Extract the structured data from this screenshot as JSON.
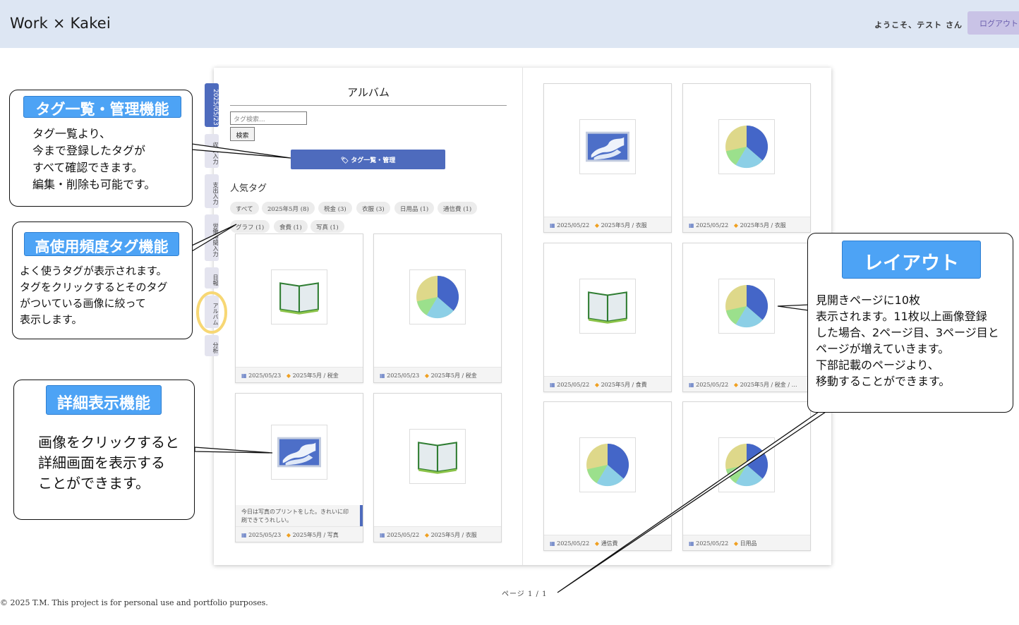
{
  "header": {
    "app_title": "Work × Kakei",
    "welcome": "ようこそ、テスト さん",
    "logout": "ログアウト"
  },
  "side_tabs": [
    {
      "label": "2025/05/23"
    },
    {
      "label": "収入入力"
    },
    {
      "label": "支出入力"
    },
    {
      "label": "労働時間入力"
    },
    {
      "label": "日報"
    },
    {
      "label": "アルバム"
    },
    {
      "label": "分析"
    }
  ],
  "album": {
    "title": "アルバム",
    "search_placeholder": "タグ検索...",
    "search_button": "検索",
    "tag_manage_button": "🏷 タグ一覧・管理",
    "popular_heading": "人気タグ",
    "tags": [
      "すべて",
      "2025年5月 (8)",
      "税金 (3)",
      "衣服 (3)",
      "日用品 (1)",
      "通信費 (1)",
      "グラフ (1)",
      "食費 (1)",
      "写真 (1)"
    ]
  },
  "cards": [
    {
      "icon": "book-icon",
      "date": "2025/05/23",
      "tag": "2025年5月 / 税金"
    },
    {
      "icon": "pie-chart-icon",
      "date": "2025/05/23",
      "tag": "2025年5月 / 税金"
    },
    {
      "icon": "photo-icon",
      "date": "2025/05/23",
      "tag": "2025年5月 / 写真",
      "note": "今日は写真のプリントをした。きれいに印刷できてうれしい。"
    },
    {
      "icon": "book-icon",
      "date": "2025/05/22",
      "tag": "2025年5月 / 衣服"
    },
    {
      "icon": "photo-icon",
      "date": "2025/05/22",
      "tag": "2025年5月 / 衣服"
    },
    {
      "icon": "pie-chart-icon",
      "date": "2025/05/22",
      "tag": "2025年5月 / 衣服"
    },
    {
      "icon": "book-icon",
      "date": "2025/05/22",
      "tag": "2025年5月 / 食費"
    },
    {
      "icon": "pie-chart-icon",
      "date": "2025/05/22",
      "tag": "2025年5月 / 税金 / …"
    },
    {
      "icon": "pie-chart-icon",
      "date": "2025/05/22",
      "tag": "通信費"
    },
    {
      "icon": "pie-chart-icon",
      "date": "2025/05/22",
      "tag": "日用品"
    }
  ],
  "pagination": {
    "label": "ページ 1 / 1"
  },
  "footer": {
    "text": "© 2025 T.M. This project is for personal use and portfolio purposes."
  },
  "callouts": {
    "tag_manage": {
      "title": "タグ一覧・管理機能",
      "body": "タグ一覧より、\n今まで登録したタグが\nすべて確認できます。\n編集・削除も可能です。"
    },
    "popular_tags": {
      "title": "高使用頻度タグ機能",
      "body": "よく使うタグが表示されます。\nタグをクリックするとそのタグ\nがついている画像に絞って\n表示します。"
    },
    "detail_view": {
      "title": "詳細表示機能",
      "body": "画像をクリックすると\n詳細画面を表示する\nことができます。"
    },
    "layout": {
      "title": "レイアウト",
      "body": "見開きページに10枚\n表示されます。11枚以上画像登録\nした場合、2ページ目、3ページ目と\nページが増えていきます。\n下部記載のページより、\n移動することができます。"
    }
  },
  "colors": {
    "header_bg": "#dde6f3",
    "accent": "#4e6bbd",
    "callout_title": "#4da3f5",
    "highlight_ring": "#f7d774"
  }
}
